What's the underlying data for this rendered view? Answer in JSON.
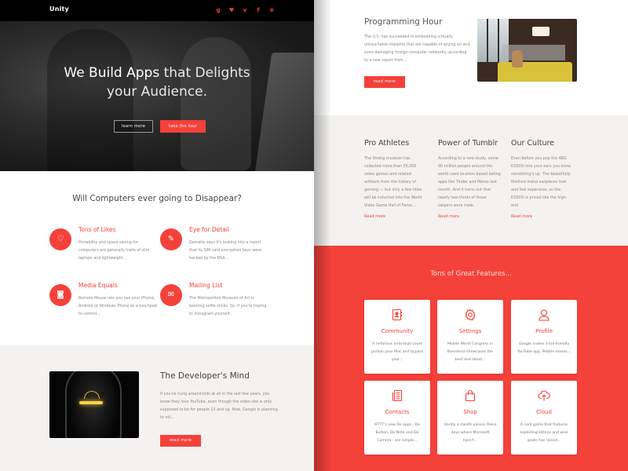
{
  "nav": {
    "brand": "Unity",
    "social": [
      {
        "icon": "google-plus-icon",
        "glyph": "g"
      },
      {
        "icon": "twitter-icon",
        "glyph": "♥"
      },
      {
        "icon": "vimeo-icon",
        "glyph": "v"
      },
      {
        "icon": "facebook-icon",
        "glyph": "f"
      },
      {
        "icon": "pinterest-icon",
        "glyph": "⊗"
      }
    ]
  },
  "hero": {
    "title_bold": "We Build Apps",
    "title_rest": " that Delights",
    "title_line2": "your Audience.",
    "learn_more": "learn more",
    "take_tour": "take the tour"
  },
  "features": {
    "heading": "Will Computers ever going to Disappear?",
    "items": [
      {
        "title": "Tons of Likes",
        "icon": "heart-icon",
        "glyph": "♡",
        "text": "Portability and space-saving for computers are generally traits of slim laptops and lightweight..."
      },
      {
        "title": "Eye for Detail",
        "icon": "pencil-icon",
        "glyph": "✎",
        "text": "Gemalto says it's looking into a report that its SIM card encryption keys were hacked by the NSA..."
      },
      {
        "title": "Media Equals",
        "icon": "camera-icon",
        "glyph": "◙",
        "text": "Remote Mouse lets you use your iPhone, Android or Windows Phone as a touchpad to control..."
      },
      {
        "title": "Mailing List",
        "icon": "envelope-icon",
        "glyph": "✉",
        "text": "The Metropolitan Museum of Art is banning selfie sticks. So, if you're hoping to Instagram yourself..."
      }
    ]
  },
  "developer": {
    "title": "The Developer's Mind",
    "text": "If you've hung around kids at all in the last few years, you know they love YouTube, even though the video site is only supposed to be for people 13 and up. Now, Google is planning to roll...",
    "button": "read more"
  },
  "programming": {
    "title": "Programming Hour",
    "text": "The U.S. has succeeded in embedding virtually untouchable implants that are capable of spying on and even damaging foreign computer networks, according to a new report from...",
    "button": "read more"
  },
  "articles": [
    {
      "title": "Pro Athletes",
      "text": "The Strong museum has collected more than 55,000 video games and related artifacts from the history of gaming — but only a few titles will be inducted into the World Video Game Hall of Fame...",
      "link": "Read more"
    },
    {
      "title": "Power of Tumblr",
      "text": "According to a new study, some 90 million people around the world used location-based dating apps like Tinder and Momo last month. And it turns out that nearly two-thirds of those swipers were male.",
      "link": "Read more"
    },
    {
      "title": "Our Culture",
      "text": "Even before you pop the AKG K3003i into your ears you know something's up. The beautifully finished metal earpieces look and feel expensive, so the K3003i is priced like the high-end",
      "link": "Read more"
    }
  ],
  "great_features": {
    "heading": "Tons of Great Features...",
    "cards": [
      {
        "title": "Community",
        "icon": "contact-book-icon",
        "text": "A nefarious individual could purloin your Mac and bypass your..."
      },
      {
        "title": "Settings",
        "icon": "gear-icon",
        "text": "Mobile World Congress in Barcelona showcases the best and latest..."
      },
      {
        "title": "Profile",
        "icon": "user-icon",
        "text": "Google makes a kid-friendly YouTube app, Pebble teases..."
      },
      {
        "title": "Contacts",
        "icon": "document-list-icon",
        "text": "IFTTT's new Do apps - Do Button, Do Note and Do Camera - are simple..."
      },
      {
        "title": "Shop",
        "icon": "shopping-bag-icon",
        "text": "Hardly a month passes these days where Microsoft hasn't..."
      },
      {
        "title": "Cloud",
        "icon": "cloud-upload-icon",
        "text": "A card game that features exploding kittens and wise goats has raised..."
      }
    ]
  },
  "colors": {
    "accent": "#f4413a",
    "nav_bg": "#000000",
    "section_grey": "#f3f2f0"
  }
}
